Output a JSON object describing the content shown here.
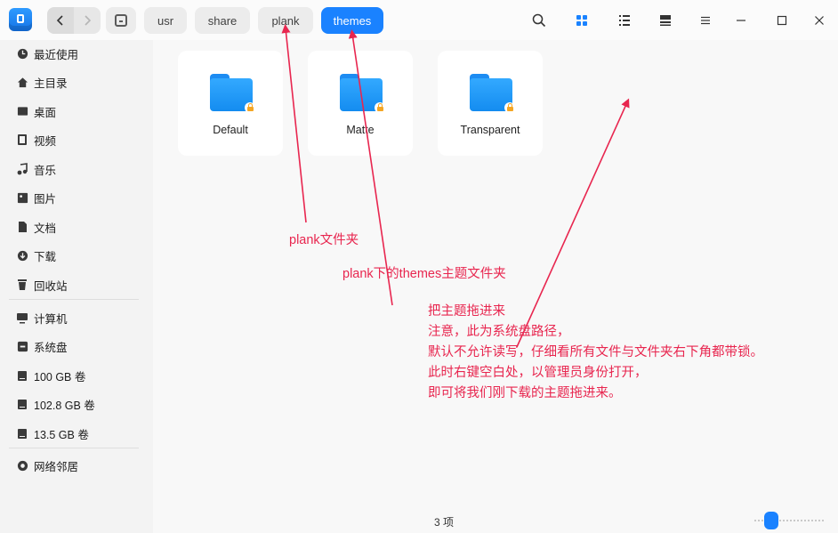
{
  "titlebar": {
    "nav": {
      "back_icon": "chevron-left-icon",
      "forward_icon": "chevron-right-icon"
    },
    "breadcrumbs": [
      {
        "label": "",
        "icon": "disk-icon"
      },
      {
        "label": "usr"
      },
      {
        "label": "share"
      },
      {
        "label": "plank"
      },
      {
        "label": "themes",
        "active": true
      }
    ],
    "tools": [
      "search-icon",
      "icon-view-icon",
      "list-view-icon",
      "detail-view-icon",
      "menu-icon",
      "minimize-icon",
      "maximize-icon",
      "close-icon"
    ]
  },
  "sidebar": {
    "items": [
      {
        "label": "最近使用",
        "icon": "clock-icon"
      },
      {
        "label": "主目录",
        "icon": "home-icon"
      },
      {
        "label": "桌面",
        "icon": "desktop-icon"
      },
      {
        "label": "视频",
        "icon": "video-icon"
      },
      {
        "label": "音乐",
        "icon": "music-icon"
      },
      {
        "label": "图片",
        "icon": "picture-icon"
      },
      {
        "label": "文档",
        "icon": "document-icon"
      },
      {
        "label": "下载",
        "icon": "download-icon"
      },
      {
        "label": "回收站",
        "icon": "trash-icon"
      },
      {
        "label": "计算机",
        "icon": "computer-icon"
      },
      {
        "label": "系统盘",
        "icon": "system-disk-icon"
      },
      {
        "label": "100 GB 卷",
        "icon": "drive-icon"
      },
      {
        "label": "102.8 GB 卷",
        "icon": "drive-icon"
      },
      {
        "label": "13.5 GB 卷",
        "icon": "drive-icon"
      },
      {
        "label": "网络邻居",
        "icon": "network-icon"
      }
    ]
  },
  "content": {
    "folders": [
      {
        "name": "Default",
        "icon": "folder-icon",
        "locked": true
      },
      {
        "name": "Matte",
        "icon": "folder-icon",
        "locked": true
      },
      {
        "name": "Transparent",
        "icon": "folder-icon",
        "locked": true
      }
    ],
    "status": "3 项"
  },
  "annotations": {
    "plank": "plank文件夹",
    "themes": "plank下的themes主题文件夹",
    "drag": [
      "把主题拖进来",
      "注意，此为系统盘路径，",
      "默认不允许读写，仔细看所有文件与文件夹右下角都带锁。",
      "此时右键空白处，以管理员身份打开，",
      "即可将我们刚下载的主题拖进来。"
    ]
  },
  "colors": {
    "accent": "#1a82ff",
    "annotation": "#e8264f",
    "folder": "#1d8cf2",
    "lock": "#f5a623"
  }
}
